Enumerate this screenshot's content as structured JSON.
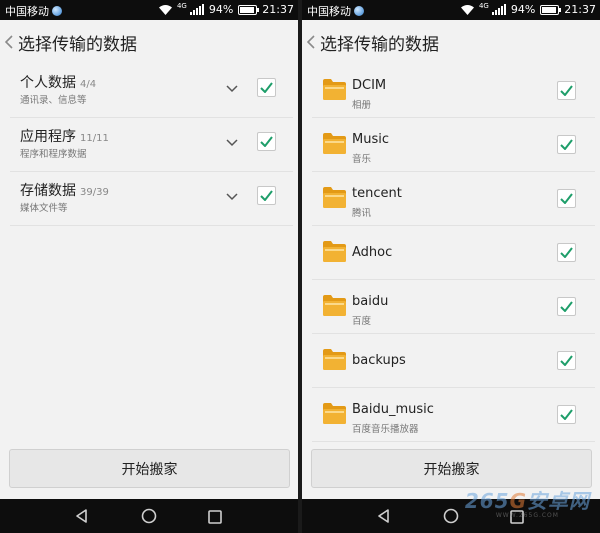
{
  "status_bar": {
    "carrier": "中国移动",
    "network": "4G",
    "battery": "94%",
    "battery_level": 0.94,
    "time": "21:37"
  },
  "header": {
    "back_icon": "chevron-left-icon",
    "title": "选择传输的数据"
  },
  "left_list": {
    "items": [
      {
        "title": "个人数据",
        "count": "4/4",
        "subtitle": "通讯录、信息等",
        "checked": true
      },
      {
        "title": "应用程序",
        "count": "11/11",
        "subtitle": "程序和程序数据",
        "checked": true
      },
      {
        "title": "存储数据",
        "count": "39/39",
        "subtitle": "媒体文件等",
        "checked": true
      }
    ]
  },
  "right_list": {
    "folder_icon": "folder-icon",
    "items": [
      {
        "name": "DCIM",
        "subtitle": "相册",
        "checked": true
      },
      {
        "name": "Music",
        "subtitle": "音乐",
        "checked": true
      },
      {
        "name": "tencent",
        "subtitle": "腾讯",
        "checked": true
      },
      {
        "name": "Adhoc",
        "subtitle": "",
        "checked": true
      },
      {
        "name": "baidu",
        "subtitle": "百度",
        "checked": true
      },
      {
        "name": "backups",
        "subtitle": "",
        "checked": true
      },
      {
        "name": "Baidu_music",
        "subtitle": "百度音乐播放器",
        "checked": true
      }
    ]
  },
  "start_button": "开始搬家",
  "nav_bar": {
    "back_icon": "triangle-back-icon",
    "home_icon": "circle-home-icon",
    "recent_icon": "square-recent-icon"
  },
  "watermark": {
    "logo_num": "265",
    "logo_g": "G",
    "logo_text": "安卓网",
    "url": "WWW.265G.COM"
  },
  "colors": {
    "check": "#1e9e6a",
    "folder": "#f2b233",
    "folder_dark": "#e39a16"
  }
}
